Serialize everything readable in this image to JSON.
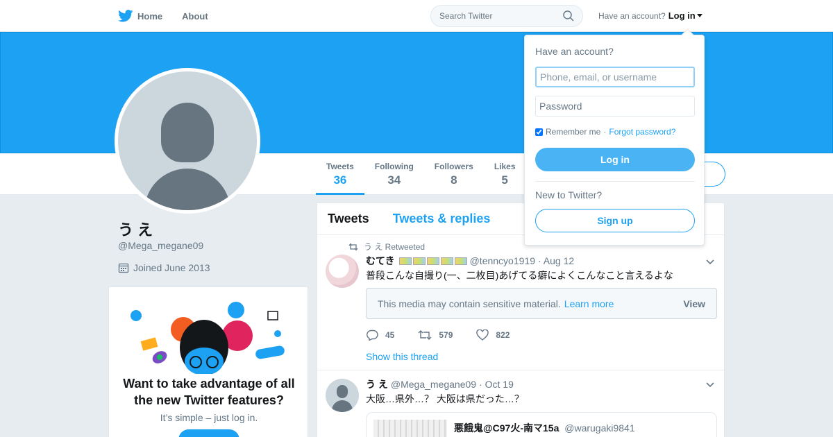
{
  "colors": {
    "brand": "#1da1f2",
    "text": "#14171a",
    "muted": "#657786",
    "background": "#e6ecf0",
    "banner": "#1da1f2"
  },
  "nav": {
    "home_label": "Home",
    "about_label": "About",
    "search_placeholder": "Search Twitter",
    "have_account": "Have an account?",
    "login_label": "Log in",
    "icons": {
      "logo": "twitter-bird-icon",
      "search": "search-icon",
      "caret": "caret-down-icon"
    }
  },
  "profile": {
    "name": "う え",
    "handle": "@Mega_megane09",
    "joined": "Joined June 2013",
    "stats": [
      {
        "label": "Tweets",
        "value": "36",
        "active": true
      },
      {
        "label": "Following",
        "value": "34",
        "active": false
      },
      {
        "label": "Followers",
        "value": "8",
        "active": false
      },
      {
        "label": "Likes",
        "value": "5",
        "active": false
      }
    ]
  },
  "promo": {
    "title": "Want to take advantage of all the new Twitter features?",
    "subtitle": "It’s simple – just log in."
  },
  "timeline": {
    "tabs": [
      {
        "label": "Tweets",
        "active": true
      },
      {
        "label": "Tweets & replies",
        "active": false
      }
    ],
    "tweets": [
      {
        "retweeted_by": "う え Retweeted",
        "name": "むてき",
        "handle": "@tenncyo1919",
        "date": "· Aug 12",
        "text": "普段こんな自撮り(一、二枚目)あげてる癖によくこんなこと言えるよな",
        "sensitive_text": "This media may contain sensitive material.",
        "learn_more": "Learn more",
        "view_label": "View",
        "replies": "45",
        "retweets": "579",
        "likes": "822",
        "show_thread": "Show this thread"
      },
      {
        "name": "う え",
        "handle": "@Mega_megane09",
        "date": "· Oct 19",
        "text": "大阪…県外…？ 大阪は県だった…？",
        "quote_name": "悪餓鬼@C97火-南マ15a",
        "quote_handle": "@warugaki9841"
      }
    ]
  },
  "login_dropdown": {
    "title": "Have an account?",
    "username_placeholder": "Phone, email, or username",
    "password_placeholder": "Password",
    "remember_label": "Remember me",
    "separator": "·",
    "forgot_label": "Forgot password?",
    "login_button": "Log in",
    "new_to_twitter": "New to Twitter?",
    "signup_button": "Sign up"
  }
}
